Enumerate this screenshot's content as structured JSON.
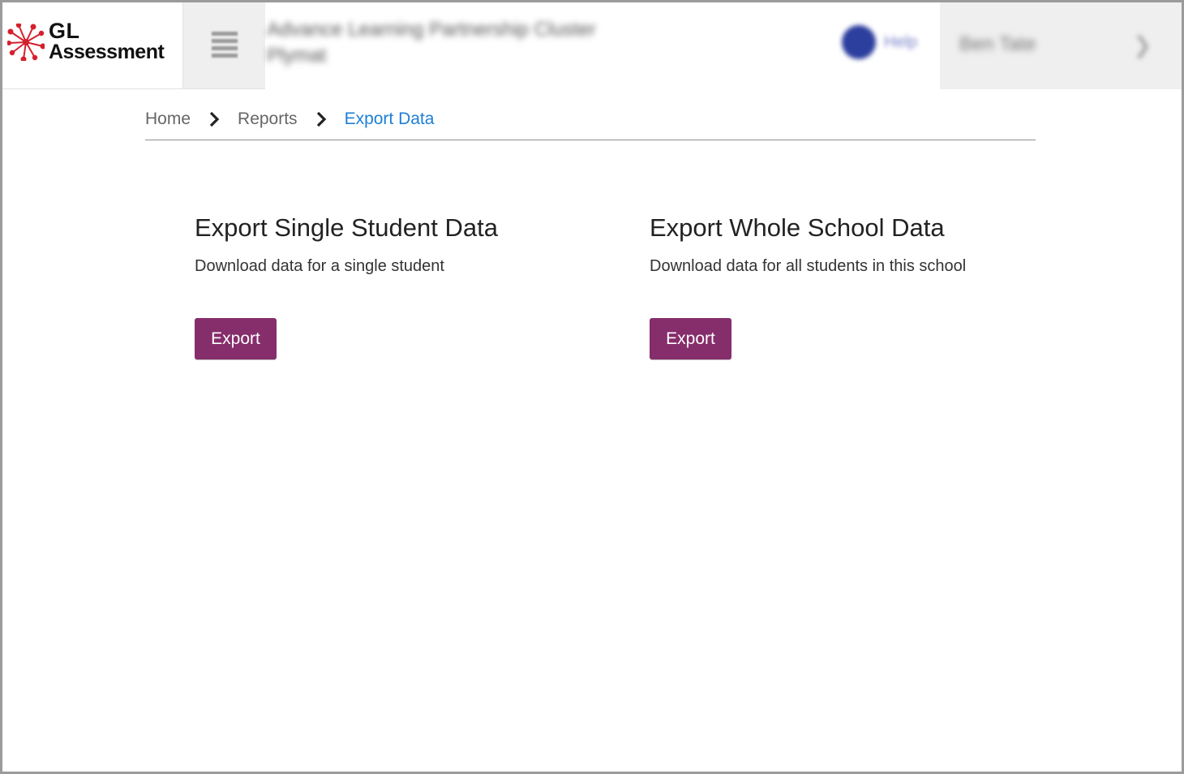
{
  "header": {
    "logo": {
      "line1": "GL",
      "line2": "Assessment"
    },
    "menu_icon": "hamburger-icon",
    "org": {
      "line1": "Advance Learning Partnership Cluster",
      "line2": "Plymat"
    },
    "help_label": "Help",
    "user_name": "Ben Tate"
  },
  "breadcrumb": {
    "items": [
      "Home",
      "Reports",
      "Export Data"
    ],
    "separator_icon": "chevron-right-icon"
  },
  "cards": [
    {
      "title": "Export Single Student Data",
      "description": "Download data for a single student",
      "button_label": "Export"
    },
    {
      "title": "Export Whole School Data",
      "description": "Download data for all students in this school",
      "button_label": "Export"
    }
  ],
  "colors": {
    "accent": "#862d6b",
    "link_active": "#1e7fd6",
    "logo_red": "#d4202c"
  }
}
